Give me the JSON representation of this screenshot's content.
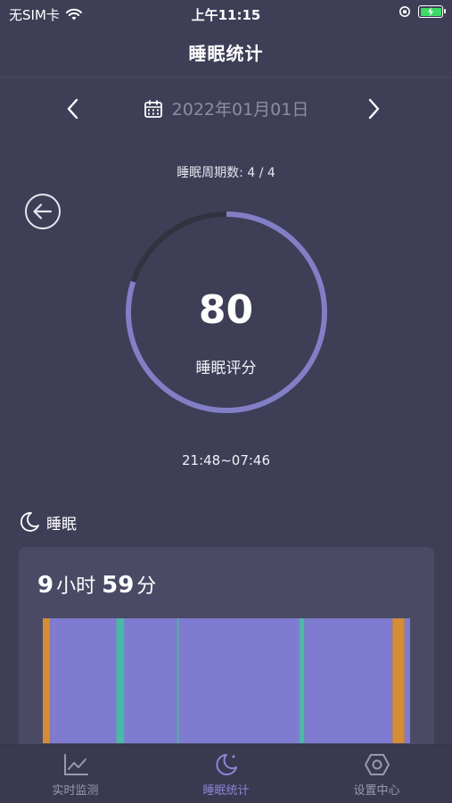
{
  "status": {
    "carrier": "无SIM卡",
    "time": "上午11:15"
  },
  "header": {
    "title": "睡眠统计"
  },
  "date_nav": {
    "date": "2022年01月01日"
  },
  "cycles": {
    "label": "睡眠周期数: 4 / 4"
  },
  "score": {
    "value": "80",
    "label": "睡眠评分",
    "fraction": 0.8
  },
  "time_range": "21:48~07:46",
  "sleep": {
    "section_title": "睡眠",
    "hours": "9",
    "hours_unit": "小时",
    "minutes": "59",
    "minutes_unit": "分",
    "stages": [
      {
        "type": "awake",
        "start": 0.0,
        "end": 0.02
      },
      {
        "type": "light",
        "start": 0.02,
        "end": 0.2
      },
      {
        "type": "rem",
        "start": 0.2,
        "end": 0.222
      },
      {
        "type": "light",
        "start": 0.222,
        "end": 0.365
      },
      {
        "type": "rem",
        "start": 0.365,
        "end": 0.37
      },
      {
        "type": "light",
        "start": 0.37,
        "end": 0.698
      },
      {
        "type": "rem",
        "start": 0.698,
        "end": 0.712
      },
      {
        "type": "light",
        "start": 0.712,
        "end": 0.952
      },
      {
        "type": "awake",
        "start": 0.952,
        "end": 0.985
      },
      {
        "type": "light",
        "start": 0.985,
        "end": 1.0
      }
    ],
    "colors": {
      "light": "#7f7bd0",
      "rem": "#4cb8a8",
      "awake": "#d58c35"
    }
  },
  "tabs": [
    {
      "label": "实时监测",
      "icon": "line-chart-icon",
      "active": false
    },
    {
      "label": "睡眠统计",
      "icon": "moon-icon",
      "active": true
    },
    {
      "label": "设置中心",
      "icon": "hexagon-settings-icon",
      "active": false
    }
  ],
  "colors": {
    "background": "#3f3e57",
    "accent": "#837fc6",
    "ring_track": "#33323f"
  }
}
